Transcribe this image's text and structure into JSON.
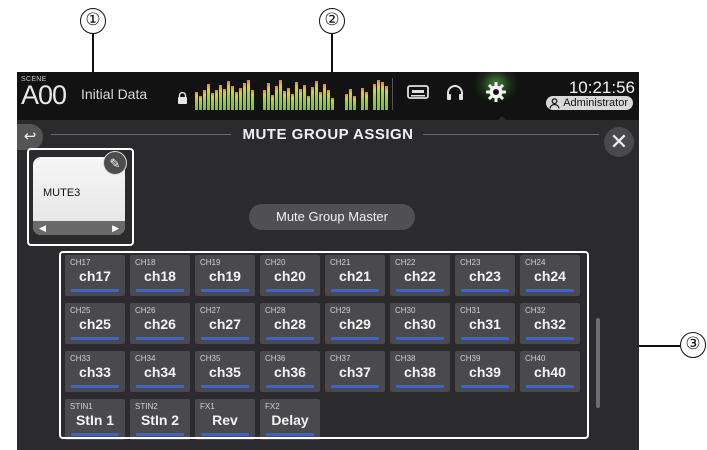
{
  "callouts": {
    "one": "①",
    "two": "②",
    "three": "③"
  },
  "topbar": {
    "scene_label": "SCENE",
    "scene_number": "A00",
    "scene_name": "Initial Data",
    "time": "10:21:56",
    "user": "Administrator"
  },
  "page": {
    "title": "MUTE GROUP ASSIGN",
    "back_symbol": "↩",
    "close_symbol": "✕"
  },
  "mute_group": {
    "label": "MUTE3",
    "edit_symbol": "✎",
    "prev_symbol": "◀",
    "next_symbol": "▶"
  },
  "master_button": "Mute Group Master",
  "channels": [
    {
      "id": "CH17",
      "name": "ch17"
    },
    {
      "id": "CH18",
      "name": "ch18"
    },
    {
      "id": "CH19",
      "name": "ch19"
    },
    {
      "id": "CH20",
      "name": "ch20"
    },
    {
      "id": "CH21",
      "name": "ch21"
    },
    {
      "id": "CH22",
      "name": "ch22"
    },
    {
      "id": "CH23",
      "name": "ch23"
    },
    {
      "id": "CH24",
      "name": "ch24"
    },
    {
      "id": "CH25",
      "name": "ch25"
    },
    {
      "id": "CH26",
      "name": "ch26"
    },
    {
      "id": "CH27",
      "name": "ch27"
    },
    {
      "id": "CH28",
      "name": "ch28"
    },
    {
      "id": "CH29",
      "name": "ch29"
    },
    {
      "id": "CH30",
      "name": "ch30"
    },
    {
      "id": "CH31",
      "name": "ch31"
    },
    {
      "id": "CH32",
      "name": "ch32"
    },
    {
      "id": "CH33",
      "name": "ch33"
    },
    {
      "id": "CH34",
      "name": "ch34"
    },
    {
      "id": "CH35",
      "name": "ch35"
    },
    {
      "id": "CH36",
      "name": "ch36"
    },
    {
      "id": "CH37",
      "name": "ch37"
    },
    {
      "id": "CH38",
      "name": "ch38"
    },
    {
      "id": "CH39",
      "name": "ch39"
    },
    {
      "id": "CH40",
      "name": "ch40"
    },
    {
      "id": "STIN1",
      "name": "StIn 1"
    },
    {
      "id": "STIN2",
      "name": "StIn 2"
    },
    {
      "id": "FX1",
      "name": "Rev"
    },
    {
      "id": "FX2",
      "name": "Delay"
    }
  ],
  "colors": {
    "accent_blue": "#2b63ff",
    "background": "#2b2b2d",
    "button": "#4a4a4c"
  }
}
